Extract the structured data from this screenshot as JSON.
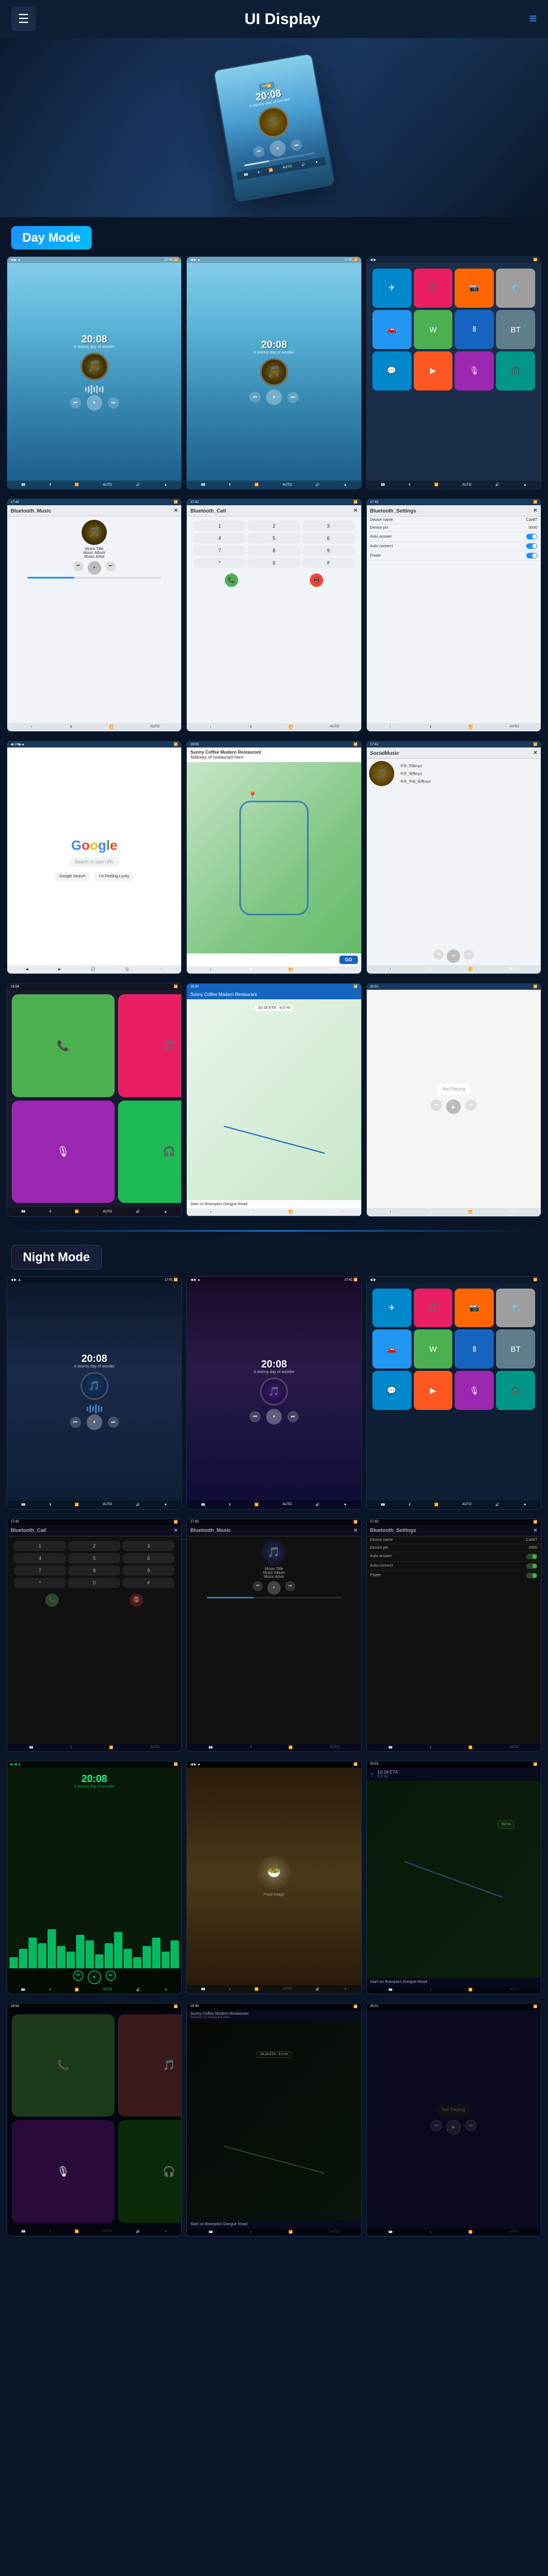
{
  "header": {
    "title": "UI Display",
    "logo_icon": "☰",
    "menu_icon": "≡"
  },
  "sections": {
    "day_label": "Day Mode",
    "night_label": "Night Mode"
  },
  "music": {
    "time": "20:08",
    "subtitle": "A stormy day of wonder",
    "title": "Music Title",
    "album": "Music Album",
    "artist": "Music Artist"
  },
  "bluetooth": {
    "music_title": "Bluetooth_Music",
    "call_title": "Bluetooth_Call",
    "settings_title": "Bluetooth_Settings",
    "device_name_label": "Device name",
    "device_name_value": "CarBT",
    "device_pin_label": "Device pin",
    "device_pin_value": "0000",
    "auto_answer_label": "Auto answer",
    "auto_connect_label": "Auto connect",
    "power_label": "Power"
  },
  "google": {
    "brand": "Google",
    "search_placeholder": "Search or type URL"
  },
  "navigation": {
    "restaurant_name": "Sunny Coffee Modern Restaurant",
    "restaurant_address": "Address of restaurant here",
    "eta_time": "10:18 ETA",
    "distance": "9.0 mi",
    "go_label": "GO",
    "instruction": "Start on Brampton Dongue Road",
    "not_playing": "Not Playing"
  },
  "apps": {
    "phone": "📞",
    "maps": "🗺",
    "music": "🎵",
    "settings": "⚙️",
    "bt": "Ⅱ",
    "telegram": "✈",
    "youtube": "▶",
    "spotify": "🎧",
    "waze": "W",
    "podcast": "🎙",
    "messages": "💬",
    "camera": "📷"
  },
  "songs": [
    "华东_开始mp3",
    "华东_闯荡mp3",
    "华东_开始_闯荡mp3"
  ],
  "colors": {
    "accent": "#1e90ff",
    "day_bg": "#87ceeb",
    "night_bg": "#0a1628",
    "green_wave": "#00ff88"
  }
}
